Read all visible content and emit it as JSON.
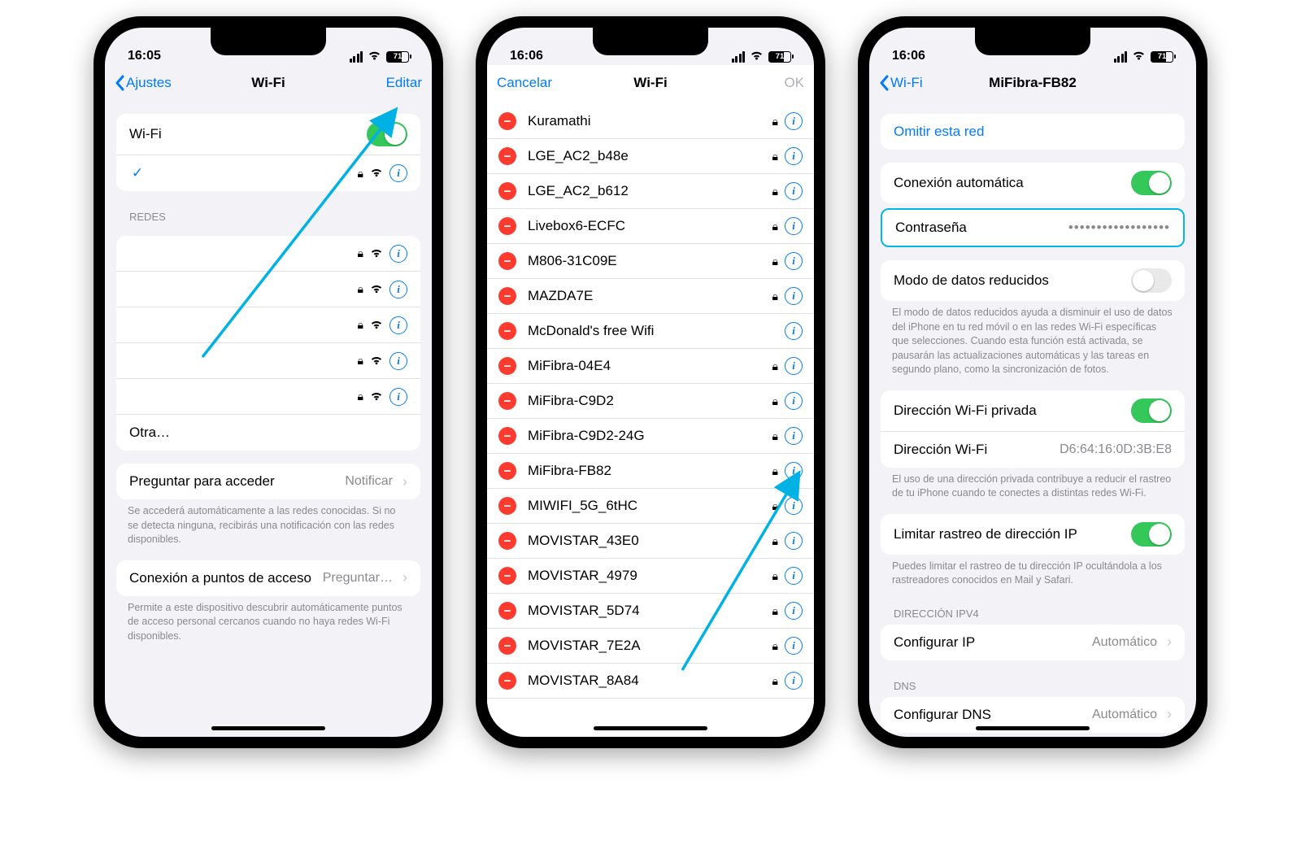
{
  "screen1": {
    "time": "16:05",
    "battery": "71",
    "back": "Ajustes",
    "title": "Wi-Fi",
    "edit": "Editar",
    "wifi_label": "Wi-Fi",
    "redes_header": "REDES",
    "otra": "Otra…",
    "ask_title": "Preguntar para acceder",
    "ask_value": "Notificar",
    "ask_footer": "Se accederá automáticamente a las redes conocidas. Si no se detecta ninguna, recibirás una notificación con las redes disponibles.",
    "hotspot_title": "Conexión a puntos de acceso",
    "hotspot_value": "Preguntar…",
    "hotspot_footer": "Permite a este dispositivo descubrir automáticamente puntos de acceso personal cercanos cuando no haya redes Wi-Fi disponibles."
  },
  "screen2": {
    "time": "16:06",
    "battery": "71",
    "cancel": "Cancelar",
    "title": "Wi-Fi",
    "ok": "OK",
    "networks": [
      {
        "name": "Kuramathi",
        "lock": true
      },
      {
        "name": "LGE_AC2_b48e",
        "lock": true
      },
      {
        "name": "LGE_AC2_b612",
        "lock": true
      },
      {
        "name": "Livebox6-ECFC",
        "lock": true
      },
      {
        "name": "M806-31C09E",
        "lock": true
      },
      {
        "name": "MAZDA7E",
        "lock": true
      },
      {
        "name": "McDonald's free Wifi",
        "lock": false
      },
      {
        "name": "MiFibra-04E4",
        "lock": true
      },
      {
        "name": "MiFibra-C9D2",
        "lock": true
      },
      {
        "name": "MiFibra-C9D2-24G",
        "lock": true
      },
      {
        "name": "MiFibra-FB82",
        "lock": true
      },
      {
        "name": "MIWIFI_5G_6tHC",
        "lock": true
      },
      {
        "name": "MOVISTAR_43E0",
        "lock": true
      },
      {
        "name": "MOVISTAR_4979",
        "lock": true
      },
      {
        "name": "MOVISTAR_5D74",
        "lock": true
      },
      {
        "name": "MOVISTAR_7E2A",
        "lock": true
      },
      {
        "name": "MOVISTAR_8A84",
        "lock": true
      }
    ]
  },
  "screen3": {
    "time": "16:06",
    "battery": "71",
    "back": "Wi-Fi",
    "title": "MiFibra-FB82",
    "forget": "Omitir esta red",
    "auto_join": "Conexión automática",
    "password_label": "Contraseña",
    "password_value": "••••••••••••••••••",
    "low_data": "Modo de datos reducidos",
    "low_data_footer": "El modo de datos reducidos ayuda a disminuir el uso de datos del iPhone en tu red móvil o en las redes Wi-Fi específicas que selecciones. Cuando esta función está activada, se pausarán las actualizaciones automáticas y las tareas en segundo plano, como la sincronización de fotos.",
    "private_addr": "Dirección Wi-Fi privada",
    "mac_label": "Dirección Wi-Fi",
    "mac_value": "D6:64:16:0D:3B:E8",
    "private_footer": "El uso de una dirección privada contribuye a reducir el rastreo de tu iPhone cuando te conectes a distintas redes Wi-Fi.",
    "ip_track": "Limitar rastreo de dirección IP",
    "ip_track_footer": "Puedes limitar el rastreo de tu dirección IP ocultándola a los rastreadores conocidos en Mail y Safari.",
    "ipv4_header": "DIRECCIÓN IPV4",
    "config_ip": "Configurar IP",
    "config_ip_val": "Automático",
    "dns_header": "DNS",
    "config_dns": "Configurar DNS",
    "config_dns_val": "Automático"
  }
}
